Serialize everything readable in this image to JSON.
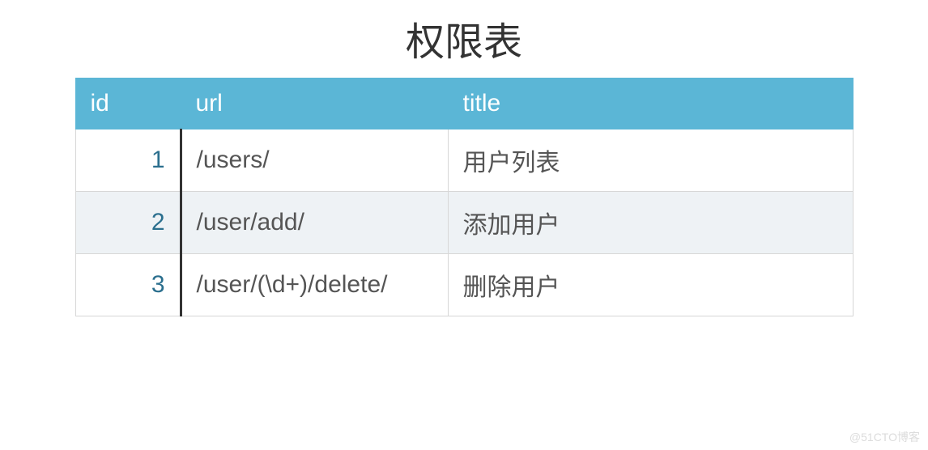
{
  "title": "权限表",
  "columns": {
    "id": "id",
    "url": "url",
    "title": "title"
  },
  "rows": [
    {
      "id": "1",
      "url": "/users/",
      "title": "用户列表"
    },
    {
      "id": "2",
      "url": "/user/add/",
      "title": "添加用户"
    },
    {
      "id": "3",
      "url": "/user/(\\d+)/delete/",
      "title": "删除用户"
    }
  ],
  "watermark": "@51CTO博客"
}
